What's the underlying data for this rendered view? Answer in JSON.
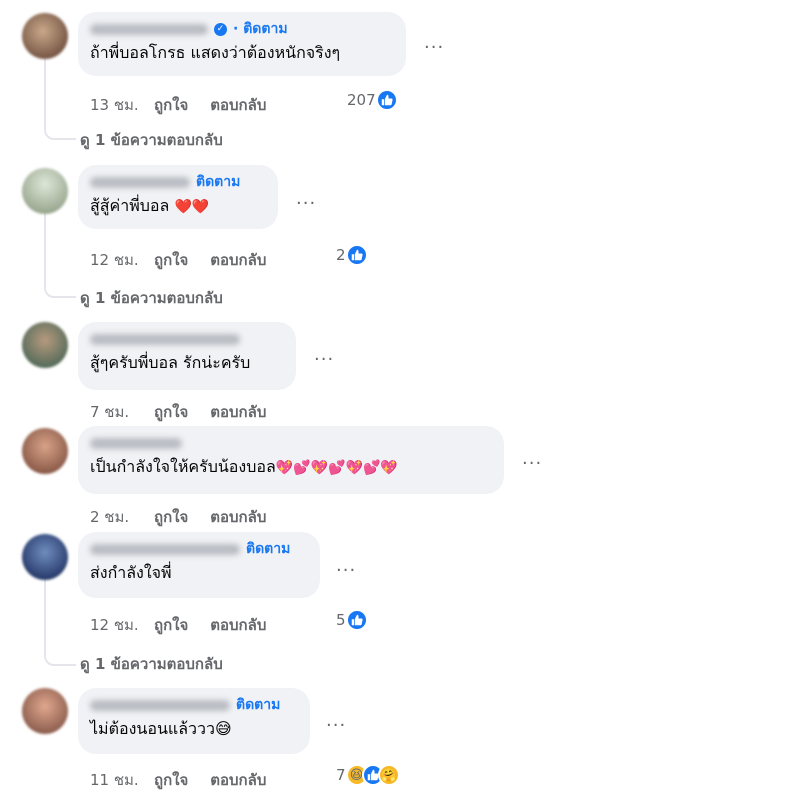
{
  "comments": [
    {
      "follow": "· ติดตาม",
      "text": "ถ้าพี่บอลโกรธ แสดงว่าต้องหนักจริงๆ",
      "time": "13 ชม.",
      "like": "ถูกใจ",
      "reply": "ตอบกลับ",
      "react_count": "207",
      "view_replies": "ดู 1 ข้อความตอบกลับ"
    },
    {
      "follow": "ติดตาม",
      "text": "สู้สู้ค่าพี่บอล",
      "text_emoji": "❤️❤️",
      "time": "12 ชม.",
      "like": "ถูกใจ",
      "reply": "ตอบกลับ",
      "react_count": "2",
      "view_replies": "ดู 1 ข้อความตอบกลับ"
    },
    {
      "follow": "",
      "text": "สู้ๆครับพี่บอล รักน่ะครับ",
      "time": "7 ชม.",
      "like": "ถูกใจ",
      "reply": "ตอบกลับ"
    },
    {
      "follow": "",
      "text": "เป็นกำลังใจให้ครับน้องบอล",
      "text_emoji": "💖💕💖💕💖💕💖",
      "time": "2 ชม.",
      "like": "ถูกใจ",
      "reply": "ตอบกลับ"
    },
    {
      "follow": "ติดตาม",
      "text": "ส่งกำลังใจพี่",
      "time": "12 ชม.",
      "like": "ถูกใจ",
      "reply": "ตอบกลับ",
      "react_count": "5",
      "view_replies": "ดู 1 ข้อความตอบกลับ"
    },
    {
      "follow": "ติดตาม",
      "text": "ไม่ต้องนอนแล้ววว",
      "text_emoji": "😅",
      "time": "11 ชม.",
      "like": "ถูกใจ",
      "reply": "ตอบกลับ",
      "react_count": "7"
    }
  ],
  "more_label": "...",
  "colors": {
    "link": "#1877f2",
    "meta": "#65676b",
    "bubble": "#f0f2f5"
  },
  "icons": [
    "more-options-icon",
    "verified-badge-icon",
    "like-reaction-icon",
    "haha-reaction-icon",
    "care-reaction-icon"
  ]
}
